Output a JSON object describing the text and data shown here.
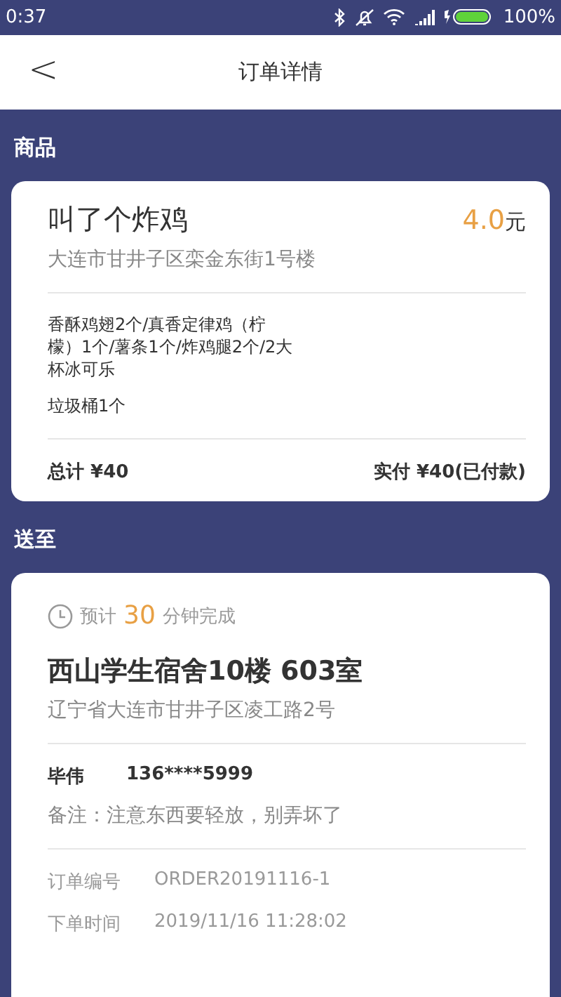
{
  "status_bar": {
    "time": "0:37",
    "battery": "100%"
  },
  "header": {
    "back": "<",
    "title": "订单详情"
  },
  "goods_section": {
    "label": "商品"
  },
  "goods_card": {
    "shop": "叫了个炸鸡",
    "price": "4.0",
    "price_unit": "元",
    "shop_address": "大连市甘井子区栾金东街1号楼",
    "items": "香酥鸡翅2个/真香定律鸡（柠檬）1个/薯条1个/炸鸡腿2个/2大杯冰可乐",
    "extra": "垃圾桶1个",
    "total": "总计 ¥40",
    "paid": "实付 ¥40(已付款)"
  },
  "delivery_section": {
    "label": "送至"
  },
  "delivery_card": {
    "eta_prefix": "预计",
    "eta_minutes": "30",
    "eta_suffix": "分钟完成",
    "place": "西山学生宿舍10楼 603室",
    "address": "辽宁省大连市甘井子区凌工路2号",
    "contact_name": "毕伟",
    "contact_phone": "136****5999",
    "note": "备注：注意东西要轻放，别弄坏了",
    "info": [
      {
        "label": "订单编号",
        "value": "ORDER20191116-1"
      },
      {
        "label": "下单时间",
        "value": "2019/11/16 11:28:02"
      }
    ]
  }
}
